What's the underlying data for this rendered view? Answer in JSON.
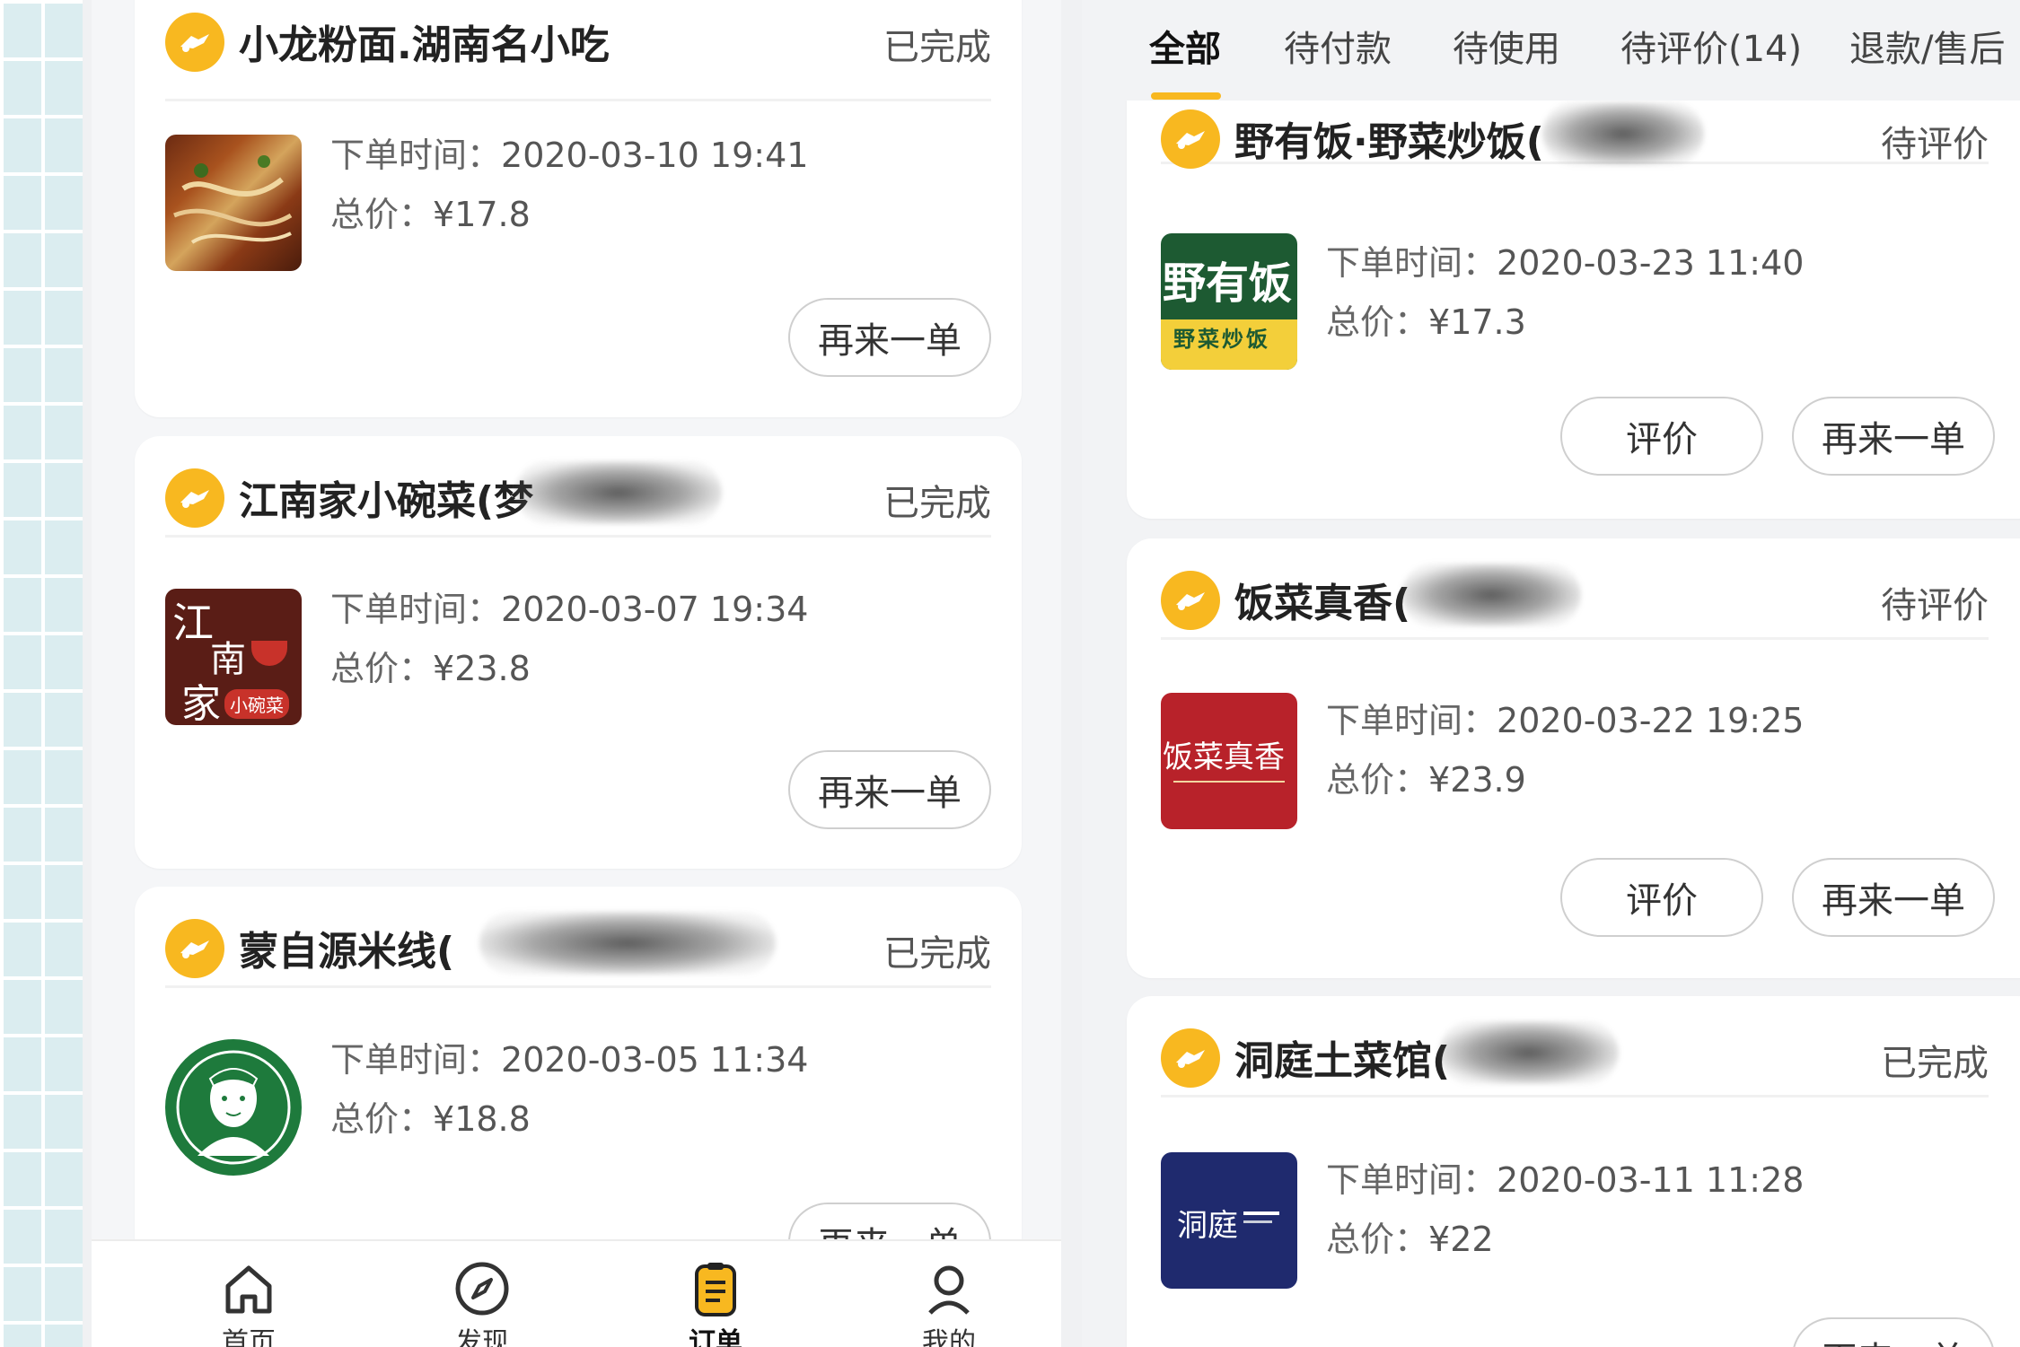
{
  "left_orders": [
    {
      "shop": "小龙粉面.湖南名小吃",
      "status": "已完成",
      "time_label": "下单时间：",
      "time": "2020-03-10 19:41",
      "price_label": "总价：",
      "price": "¥17.8",
      "reorder": "再来一单"
    },
    {
      "shop": "江南家小碗菜(梦",
      "status": "已完成",
      "time_label": "下单时间：",
      "time": "2020-03-07 19:34",
      "price_label": "总价：",
      "price": "¥23.8",
      "reorder": "再来一单"
    },
    {
      "shop": "蒙自源米线(",
      "status": "已完成",
      "time_label": "下单时间：",
      "time": "2020-03-05 11:34",
      "price_label": "总价：",
      "price": "¥18.8",
      "reorder": "再来一单"
    }
  ],
  "thumb_text": {
    "jiangnan": [
      "江",
      "南",
      "家"
    ],
    "jiangnan_badge": "小碗菜",
    "yeyoufan": "野有饭",
    "yeyoufan_sub": "野菜炒饭",
    "fancai": "饭菜真香",
    "dongting": "洞庭"
  },
  "tabs": [
    "全部",
    "待付款",
    "待使用",
    "待评价(14)",
    "退款/售后"
  ],
  "right_orders": [
    {
      "shop": "野有饭·野菜炒饭(",
      "status": "待评价",
      "time_label": "下单时间：",
      "time": "2020-03-23 11:40",
      "price_label": "总价：",
      "price": "¥17.3",
      "review": "评价",
      "reorder": "再来一单"
    },
    {
      "shop": "饭菜真香(",
      "status": "待评价",
      "time_label": "下单时间：",
      "time": "2020-03-22 19:25",
      "price_label": "总价：",
      "price": "¥23.9",
      "review": "评价",
      "reorder": "再来一单"
    },
    {
      "shop": "洞庭土菜馆(",
      "status": "已完成",
      "time_label": "下单时间：",
      "time": "2020-03-11 11:28",
      "price_label": "总价：",
      "price": "¥22",
      "reorder": "再来一单"
    }
  ],
  "bottom_nav": [
    "首页",
    "发现",
    "订单",
    "我的"
  ],
  "colors": {
    "accent": "#f8b820",
    "card": "#ffffff",
    "background": "#f5f6f8"
  }
}
